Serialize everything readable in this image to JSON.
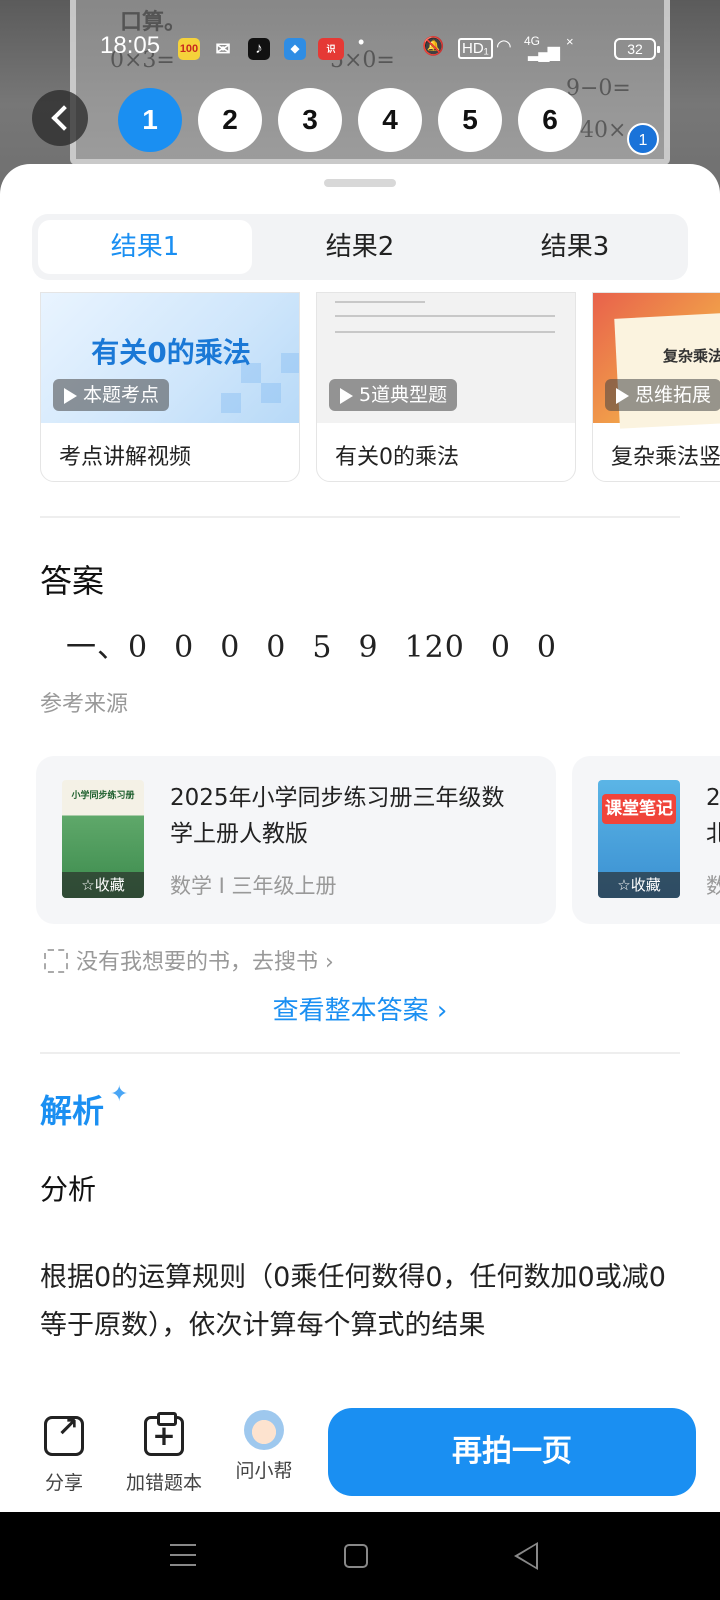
{
  "status_bar": {
    "time": "18:05",
    "app_icons": [
      "app-100-icon",
      "wechat-icon",
      "douyin-icon",
      "browser-icon",
      "app-shibie-icon"
    ],
    "hd_label": "HD₁",
    "network_label": "4G",
    "battery": "32"
  },
  "photo": {
    "lines": [
      "口算。",
      "0×3=",
      "5×0=",
      "9−0=",
      "40×"
    ]
  },
  "pages": {
    "items": [
      "1",
      "2",
      "3",
      "4",
      "5",
      "6"
    ],
    "active_index": 0,
    "photo_count": "1"
  },
  "tabs": {
    "items": [
      "结果1",
      "结果2",
      "结果3"
    ],
    "active_index": 0
  },
  "video_cards": [
    {
      "thumb_title": "有关0的乘法",
      "tag": "本题考点",
      "caption": "考点讲解视频"
    },
    {
      "thumb_title": "",
      "tag": "5道典型题",
      "caption": "有关0的乘法"
    },
    {
      "thumb_title": "复杂乘法竖",
      "tag": "思维拓展",
      "caption": "复杂乘法竖"
    }
  ],
  "answer": {
    "title": "答案",
    "prefix": "一、",
    "values": [
      "0",
      "0",
      "0",
      "0",
      "5",
      "9",
      "120",
      "0",
      "0"
    ]
  },
  "reference": {
    "title": "参考来源",
    "books": [
      {
        "cover_text": "小学同步练习册",
        "title": "2025年小学同步练习册三年级数学上册人教版",
        "meta": "数学 I 三年级上册",
        "fav_label": "☆收藏"
      },
      {
        "cover_text": "课堂笔记",
        "title": "2北",
        "meta": "数",
        "fav_label": "☆收藏"
      }
    ],
    "search_hint": "没有我想要的书，去搜书",
    "view_all": "查看整本答案"
  },
  "analysis": {
    "title": "解析",
    "subtitle": "分析",
    "text": "根据0的运算规则（0乘任何数得0，任何数加0或减0等于原数），依次计算每个算式的结果"
  },
  "action_bar": {
    "share_label": "分享",
    "add_wrong_label": "加错题本",
    "ask_label": "问小帮",
    "retake_label": "再拍一页"
  },
  "colors": {
    "accent": "#1a8ff2",
    "muted": "#999999"
  }
}
